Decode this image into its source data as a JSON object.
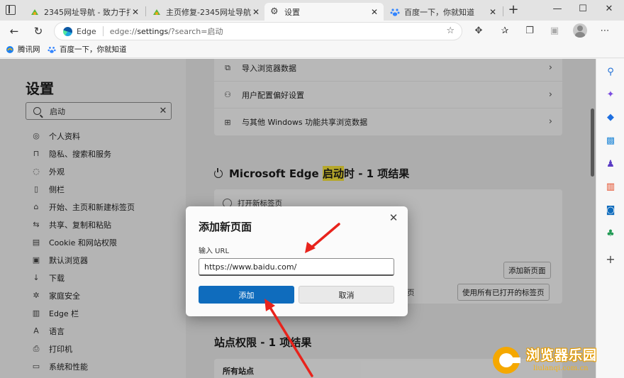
{
  "tabs": [
    {
      "title": "2345网址导航 - 致力于打造",
      "active": false
    },
    {
      "title": "主页修复-2345网址导航",
      "active": false
    },
    {
      "title": "设置",
      "active": true
    },
    {
      "title": "百度一下，你就知道",
      "active": false
    }
  ],
  "window_controls": {
    "minimize": "—",
    "maximize": "☐",
    "close": "✕"
  },
  "address_bar": {
    "browser_chip": "Edge",
    "url_scheme": "edge://",
    "url_host": "settings",
    "url_path": "/?search=启动"
  },
  "favorites": [
    {
      "label": "腾讯网"
    },
    {
      "label": "百度一下，你就知道"
    }
  ],
  "settings": {
    "title": "设置",
    "search_value": "启动",
    "nav_items": [
      {
        "label": "个人资料",
        "icon": "person-icon"
      },
      {
        "label": "隐私、搜索和服务",
        "icon": "lock-icon"
      },
      {
        "label": "外观",
        "icon": "palette-icon"
      },
      {
        "label": "侧栏",
        "icon": "sidebar-icon"
      },
      {
        "label": "开始、主页和新建标签页",
        "icon": "home-icon"
      },
      {
        "label": "共享、复制和粘贴",
        "icon": "share-icon"
      },
      {
        "label": "Cookie 和网站权限",
        "icon": "cookie-icon"
      },
      {
        "label": "默认浏览器",
        "icon": "browser-icon"
      },
      {
        "label": "下载",
        "icon": "download-icon"
      },
      {
        "label": "家庭安全",
        "icon": "family-icon"
      },
      {
        "label": "Edge 栏",
        "icon": "edge-bar-icon"
      },
      {
        "label": "语言",
        "icon": "language-icon"
      },
      {
        "label": "打印机",
        "icon": "printer-icon"
      },
      {
        "label": "系统和性能",
        "icon": "system-icon"
      }
    ]
  },
  "main": {
    "profile_rows": [
      {
        "label": "导入浏览器数据",
        "icon": "import-icon"
      },
      {
        "label": "用户配置偏好设置",
        "icon": "users-gear-icon"
      },
      {
        "label": "与其他 Windows 功能共享浏览数据",
        "icon": "windows-icon"
      }
    ],
    "startup_section": {
      "prefix": "Microsoft Edge ",
      "highlight": "启动",
      "suffix": "时 - 1 项结果"
    },
    "radio_label": "打开新标签页",
    "add_page_button": "添加新页面",
    "partial_text": "页",
    "use_open_tabs_button": "使用所有已打开的标签页",
    "site_section": {
      "title": "站点权限 - 1 项结果"
    },
    "all_sites": "所有站点"
  },
  "modal": {
    "title": "添加新页面",
    "close": "✕",
    "label": "输入 URL",
    "input_value": "https://www.baidu.com/",
    "add_button": "添加",
    "cancel_button": "取消"
  },
  "sidebar_icons": [
    "search-icon",
    "copilot-icon",
    "shopping-tag-icon",
    "tools-icon",
    "games-icon",
    "office-icon",
    "outlook-icon",
    "tree-icon",
    "add-icon"
  ],
  "watermark": {
    "title": "浏览器乐园",
    "subtitle": "liulanqi.com.cn"
  }
}
